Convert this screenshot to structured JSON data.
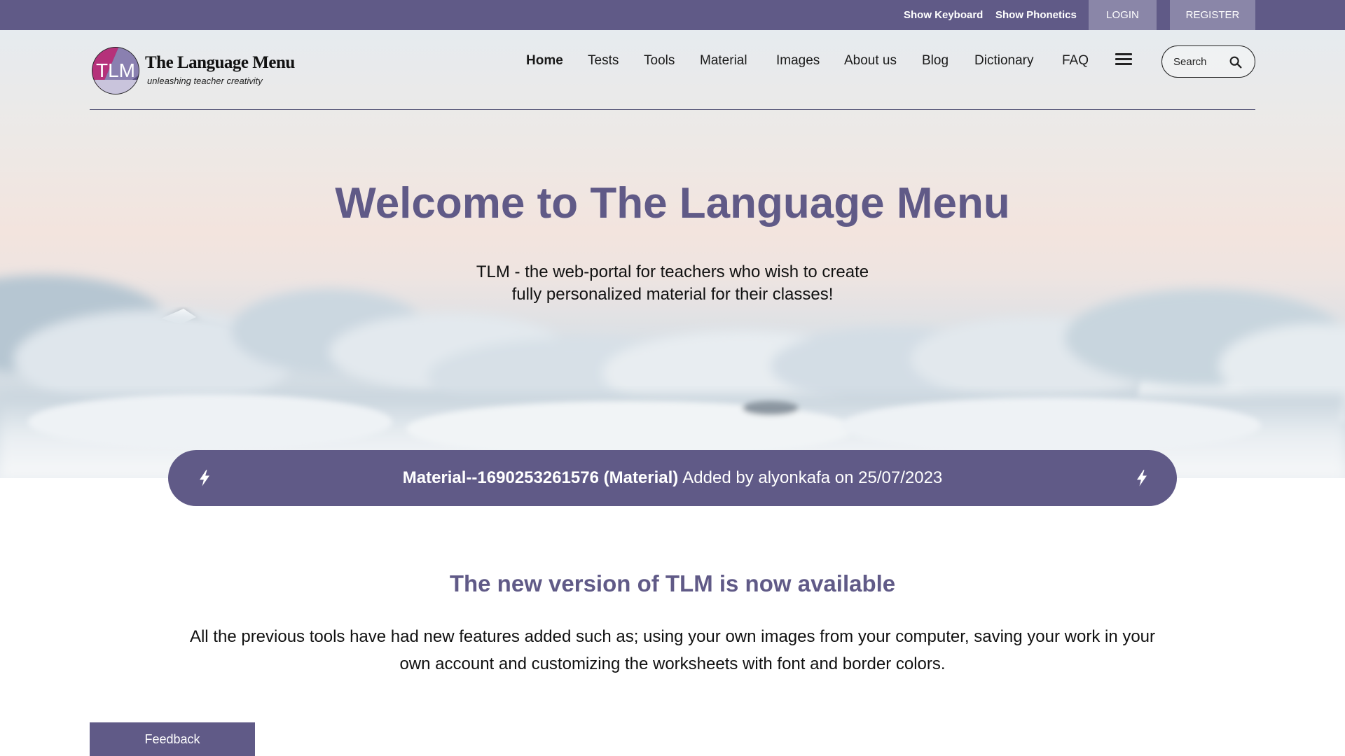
{
  "topbar": {
    "show_keyboard": "Show Keyboard",
    "show_phonetics": "Show Phonetics",
    "login": "LOGIN",
    "register": "REGISTER"
  },
  "logo": {
    "monogram": "TLM",
    "name": "The Language Menu",
    "tagline": "unleashing teacher creativity"
  },
  "nav": {
    "items": [
      "Home",
      "Tests",
      "Tools",
      "Material",
      "Images",
      "About us",
      "Blog",
      "Dictionary",
      "FAQ"
    ],
    "active": "Home",
    "menu_icon": "hamburger-menu-icon"
  },
  "search": {
    "placeholder": "Search",
    "icon": "search-icon"
  },
  "hero": {
    "title": "Welcome to The Language Menu",
    "subtitle_line1": "TLM - the web-portal for teachers who wish to create",
    "subtitle_line2": "fully personalized material for their classes!"
  },
  "announcement": {
    "item": "Material--1690253261576 (Material)",
    "meta": "Added by alyonkafa on 25/07/2023",
    "icon": "lightning-bolt-icon"
  },
  "section": {
    "title": "The new version of TLM is now available",
    "text": "All the previous tools have had new features added such as; using your own images from your computer, saving your work in your own account and customizing the worksheets with font and border colors."
  },
  "feedback": {
    "label": "Feedback"
  },
  "colors": {
    "brand": "#605a87",
    "brand_light": "#8a86a8",
    "text": "#111111"
  }
}
